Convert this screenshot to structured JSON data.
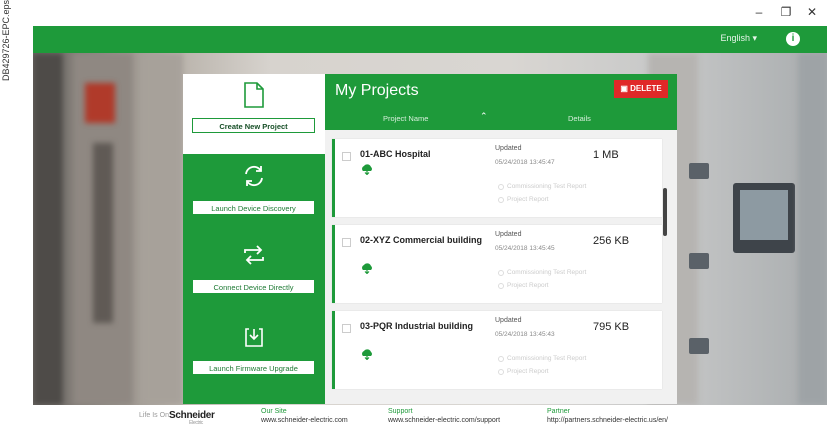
{
  "doc_label": "DB429726-EPC.eps",
  "window": {
    "minimize": "–",
    "maximize": "❐",
    "close": "✕"
  },
  "topbar": {
    "language": "English ▾",
    "info_icon": "i"
  },
  "actions": [
    {
      "label": "Create New Project",
      "icon": "document-icon"
    },
    {
      "label": "Launch Device Discovery",
      "icon": "refresh-icon"
    },
    {
      "label": "Connect Device Directly",
      "icon": "swap-icon"
    },
    {
      "label": "Launch Firmware Upgrade",
      "icon": "download-icon"
    }
  ],
  "projects_panel": {
    "title": "My Projects",
    "delete_label": "DELETE",
    "col_name": "Project Name",
    "col_sort": "⌃",
    "col_details": "Details"
  },
  "projects": [
    {
      "name": "01-ABC Hospital",
      "updated": "Updated",
      "date": "05/24/2018 13:45:47",
      "size": "1 MB",
      "link1": "Commissioning Test Report",
      "link2": "Project Report"
    },
    {
      "name": "02-XYZ Commercial building",
      "updated": "Updated",
      "date": "05/24/2018 13:45:45",
      "size": "256 KB",
      "link1": "Commissioning Test Report",
      "link2": "Project Report"
    },
    {
      "name": "03-PQR Industrial building",
      "updated": "Updated",
      "date": "05/24/2018 13:45:43",
      "size": "795 KB",
      "link1": "Commissioning Test Report",
      "link2": "Project Report"
    }
  ],
  "footer": {
    "life_is_on": "Life Is On",
    "brand": "Schneider",
    "brand_sub": "Electric",
    "our_site_h": "Our Site",
    "our_site_v": "www.schneider-electric.com",
    "support_h": "Support",
    "support_v": "www.schneider-electric.com/support",
    "partner_h": "Partner",
    "partner_v": "http://partners.schneider-electric.us/en/"
  },
  "colors": {
    "brand_green": "#1e9a3a",
    "delete_red": "#e02828"
  }
}
